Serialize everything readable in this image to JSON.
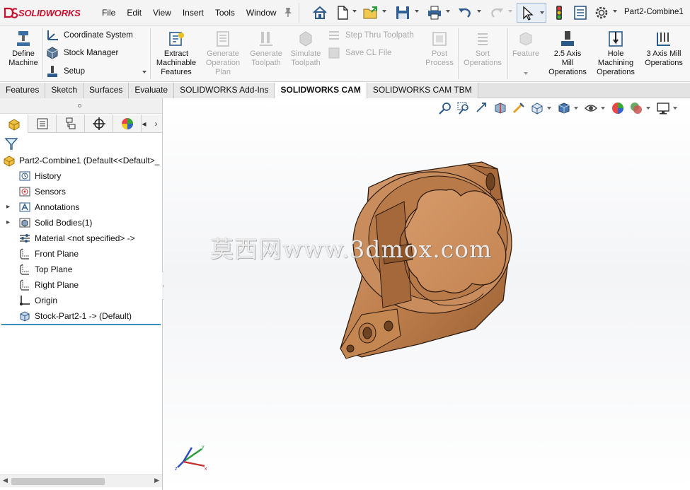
{
  "app": {
    "brand": "SOLIDWORKS",
    "document_title": "Part2-Combine1"
  },
  "menu": [
    "File",
    "Edit",
    "View",
    "Insert",
    "Tools",
    "Window"
  ],
  "quick_access": [
    "home-icon",
    "new-document-icon",
    "open-icon",
    "save-icon",
    "print-icon",
    "undo-icon",
    "redo-icon",
    "select-icon",
    "rebuild-icon",
    "file-properties-icon",
    "options-icon"
  ],
  "command_manager": {
    "define_machine": "Define\nMachine",
    "coordinate_system": "Coordinate System",
    "stock_manager": "Stock Manager",
    "setup": "Setup",
    "extract_features": "Extract\nMachinable\nFeatures",
    "generate_operation_plan": "Generate\nOperation\nPlan",
    "generate_toolpath": "Generate\nToolpath",
    "simulate_toolpath": "Simulate\nToolpath",
    "step_thru_toolpath": "Step Thru Toolpath",
    "save_cl_file": "Save CL File",
    "post_process": "Post\nProcess",
    "sort_operations": "Sort\nOperations",
    "feature": "Feature",
    "axis25_mill": "2.5 Axis\nMill\nOperations",
    "hole_machining": "Hole\nMachining\nOperations",
    "axis3_mill": "3 Axis Mill\nOperations"
  },
  "tabs": [
    {
      "label": "Features",
      "active": false
    },
    {
      "label": "Sketch",
      "active": false
    },
    {
      "label": "Surfaces",
      "active": false
    },
    {
      "label": "Evaluate",
      "active": false
    },
    {
      "label": "SOLIDWORKS Add-Ins",
      "active": false
    },
    {
      "label": "SOLIDWORKS CAM",
      "active": true
    },
    {
      "label": "SOLIDWORKS CAM TBM",
      "active": false
    }
  ],
  "feature_tree": {
    "root": "Part2-Combine1  (Default<<Default>_",
    "items": [
      {
        "label": "History",
        "icon": "history-icon",
        "expandable": false
      },
      {
        "label": "Sensors",
        "icon": "sensors-icon",
        "expandable": false
      },
      {
        "label": "Annotations",
        "icon": "annotations-icon",
        "expandable": true
      },
      {
        "label": "Solid Bodies(1)",
        "icon": "solid-bodies-icon",
        "expandable": true
      },
      {
        "label": "Material <not specified> ->",
        "icon": "material-icon",
        "expandable": false
      },
      {
        "label": "Front Plane",
        "icon": "plane-icon",
        "expandable": false
      },
      {
        "label": "Top Plane",
        "icon": "plane-icon",
        "expandable": false
      },
      {
        "label": "Right Plane",
        "icon": "plane-icon",
        "expandable": false
      },
      {
        "label": "Origin",
        "icon": "origin-icon",
        "expandable": false
      },
      {
        "label": "Stock-Part2-1 -> (Default)",
        "icon": "stock-icon",
        "expandable": false
      }
    ]
  },
  "viewport": {
    "watermark": "莫西网www.3dmox.com"
  },
  "colors": {
    "brand": "#c8102e",
    "part": "#b8784a",
    "selection_rule": "#3a8fbf"
  }
}
